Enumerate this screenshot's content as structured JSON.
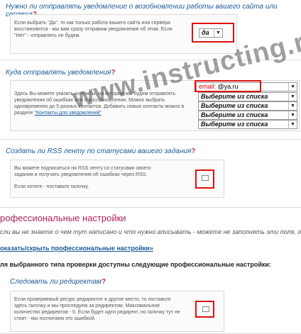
{
  "q1": {
    "title": "Нужно ли отправлять уведомление о возобновлении работы вашего сайта или сервера",
    "mark": "?",
    "desc": "Если выбрать \"Да\", то как только работа вашего сайта или сервера восстановится - мы вам сразу отправим уведомление об этом. Если \"Нет\" - отправлять не будем.",
    "select_value": "да",
    "arrow": "▼"
  },
  "q2": {
    "title": "Куда отправлять уведомления",
    "mark": "?",
    "desc": "Здесь Вы можете указать контакты, на которые мы будем отправлять уведомления об ошибках или о восстановлении. Можно выбрать одновременно до 5 разных контактов. Добавить новые контакты можно в разделе",
    "desc_link": "\"Контакты для уведомлений\"",
    "first_contact": "email:",
    "first_contact_value": "@ya.ru",
    "options": [
      "Выберите из списка",
      "Выберите из списка",
      "Выберите из списка",
      "Выберите из списка"
    ],
    "arrow": "▼"
  },
  "q3": {
    "title": "Создать ли RSS ленту по статусами вашего задания",
    "mark": "?",
    "desc1": "Вы можете подписаться на RSS ленту со статусами своего задания и получать уведомления об ошибках через RSS.",
    "desc2": "Если хотите - поставьте галочку."
  },
  "pro": {
    "heading": "рофессиональные настройки",
    "note": "сли вы не знаете о чем тут написано и что нужно вписывать - можете не заполнять эти поля, о",
    "toggle_link": "оказать/скрыть профессиональные настройки»",
    "subheading": "ля выбранного типа проверки доступны следующие профессиональные настройки:"
  },
  "q4": {
    "title": "Следовать ли редиректам",
    "mark": "?",
    "desc": "Если проверяемый ресурс редиректит в другое место, то поставьте здесь галочку и мы проследуем за редиректом. Максимальное количество редиректов - 5. Если будет идти редирект, но галочку тут не стоит - мы посчитаем это ошибкой."
  },
  "watermark": "www.instructing.ru"
}
